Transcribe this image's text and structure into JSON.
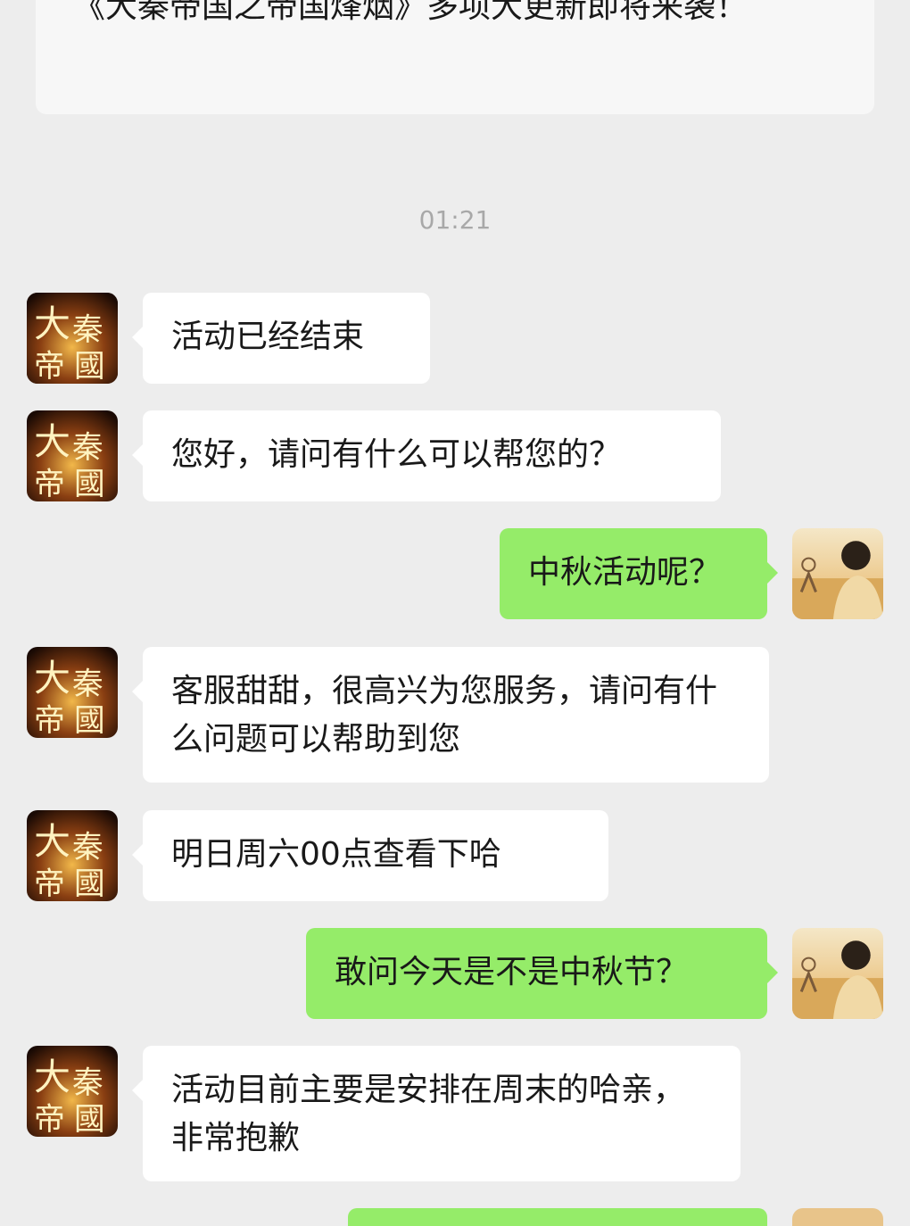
{
  "top_card": {
    "text": "《大秦帝国之帝国烽烟》多项大更新即将来袭！"
  },
  "timestamp": "01:21",
  "messages": [
    {
      "sender": "service",
      "text": "活动已经结束"
    },
    {
      "sender": "service",
      "text": "您好，请问有什么可以帮您的？"
    },
    {
      "sender": "me",
      "text": "中秋活动呢？"
    },
    {
      "sender": "service",
      "text": "客服甜甜，很高兴为您服务，请问有什么问题可以帮助到您"
    },
    {
      "sender": "service",
      "text": "明日周六00点查看下哈"
    },
    {
      "sender": "me",
      "text": "敢问今天是不是中秋节？"
    },
    {
      "sender": "service",
      "text": "活动目前主要是安排在周末的哈亲，非常抱歉"
    }
  ],
  "avatars": {
    "service_icon": "game-logo-avatar",
    "me_icon": "user-photo-avatar"
  },
  "colors": {
    "background": "#ededed",
    "incoming_bubble": "#ffffff",
    "outgoing_bubble": "#95ec69",
    "timestamp": "#a8a8a8"
  }
}
